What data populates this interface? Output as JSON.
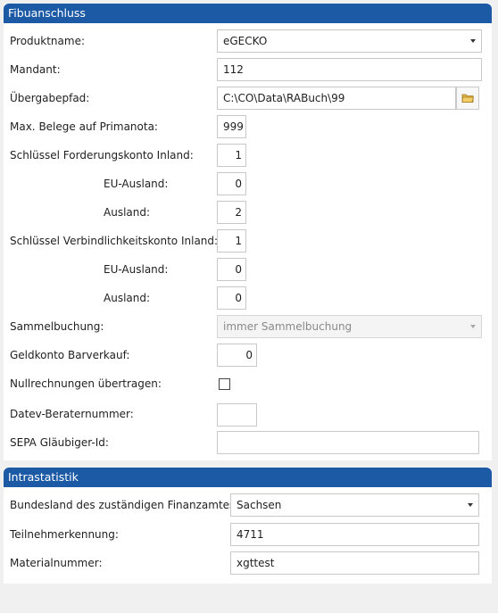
{
  "fibu": {
    "title": "Fibuanschluss",
    "produktname": {
      "label": "Produktname:",
      "value": "eGECKO"
    },
    "mandant": {
      "label": "Mandant:",
      "value": "112"
    },
    "uebergabepfad": {
      "label": "Übergabepfad:",
      "value": "C:\\CO\\Data\\RABuch\\99",
      "browse_icon": "folder-icon"
    },
    "max_belege": {
      "label": "Max. Belege auf Primanota:",
      "value": "999"
    },
    "forderung_inland": {
      "label": "Schlüssel Forderungskonto Inland:",
      "value": "1"
    },
    "forderung_eu": {
      "label": "EU-Ausland:",
      "value": "0"
    },
    "forderung_ausland": {
      "label": "Ausland:",
      "value": "2"
    },
    "verbindlich_inland": {
      "label": "Schlüssel Verbindlichkeitskonto Inland:",
      "value": "1"
    },
    "verbindlich_eu": {
      "label": "EU-Ausland:",
      "value": "0"
    },
    "verbindlich_ausland": {
      "label": "Ausland:",
      "value": "0"
    },
    "sammelbuchung": {
      "label": "Sammelbuchung:",
      "value": "immer Sammelbuchung",
      "disabled": true
    },
    "geldkonto": {
      "label": "Geldkonto Barverkauf:",
      "value": "0"
    },
    "nullrechnungen": {
      "label": "Nullrechnungen übertragen:",
      "checked": false
    },
    "datev": {
      "label": "Datev-Beraternummer:",
      "value": ""
    },
    "sepa": {
      "label": "SEPA Gläubiger-Id:",
      "value": ""
    }
  },
  "intra": {
    "title": "Intrastatistik",
    "bundesland": {
      "label": "Bundesland des zuständigen Finanzamtes:",
      "value": "Sachsen"
    },
    "teilnehmer": {
      "label": "Teilnehmerkennung:",
      "value": "4711"
    },
    "material": {
      "label": "Materialnummer:",
      "value": "xgttest"
    }
  },
  "colors": {
    "header": "#1d5aa6",
    "panel": "#ffffff",
    "background": "#f0f0f0",
    "folder": "#e0b44c"
  }
}
